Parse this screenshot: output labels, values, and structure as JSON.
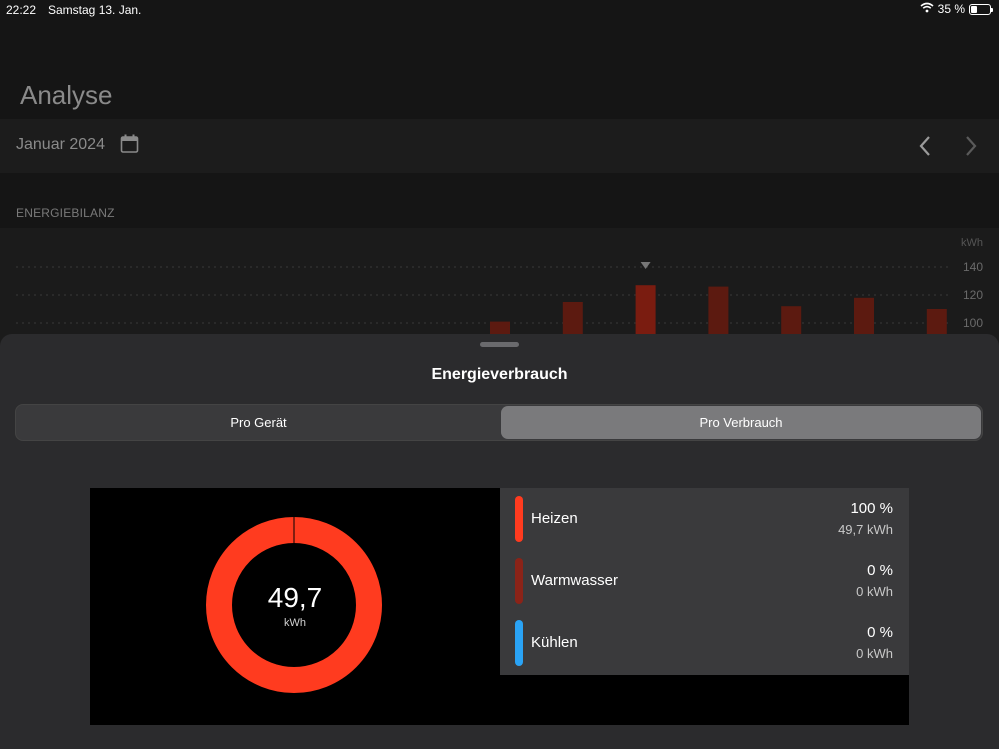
{
  "status": {
    "time": "22:22",
    "date": "Samstag 13. Jan.",
    "battery_text": "35 %",
    "battery_level": 0.35
  },
  "header": {
    "title": "Analyse",
    "month": "Januar 2024",
    "section_label": "ENERGIEBILANZ"
  },
  "chart_data": {
    "type": "bar",
    "ylabel": "kWh",
    "yticks": [
      "140",
      "120",
      "100"
    ],
    "ylim": [
      75,
      150
    ],
    "values": [
      101,
      115,
      127,
      126,
      112,
      118,
      110
    ],
    "selected_index": 2,
    "bar_color": "#5c1a10",
    "selected_color": "#7a1c10"
  },
  "sheet": {
    "title": "Energieverbrauch",
    "tabs": [
      {
        "label": "Pro Gerät",
        "selected": false
      },
      {
        "label": "Pro Verbrauch",
        "selected": true
      }
    ],
    "donut": {
      "value": "49,7",
      "unit": "kWh",
      "fraction": 1.0,
      "color": "#ff3b1f"
    },
    "legend": [
      {
        "name": "Heizen",
        "percent": "100 %",
        "kwh": "49,7 kWh",
        "color": "#ff3b1f"
      },
      {
        "name": "Warmwasser",
        "percent": "0 %",
        "kwh": "0 kWh",
        "color": "#8b2318"
      },
      {
        "name": "Kühlen",
        "percent": "0 %",
        "kwh": "0 kWh",
        "color": "#2aa3f5"
      }
    ]
  }
}
